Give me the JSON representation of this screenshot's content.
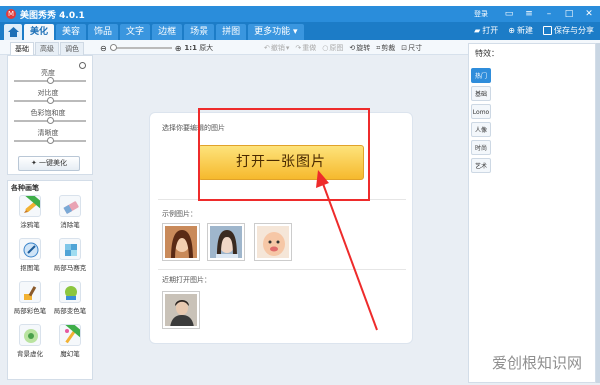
{
  "app": {
    "title": "美图秀秀 4.0.1",
    "logo_glyph": "M",
    "login": "登录"
  },
  "window_controls": {
    "skin_icon": "skin-icon",
    "menu_icon": "menu-icon",
    "minimize": "–",
    "maximize": "□",
    "close": "✕"
  },
  "menu": {
    "tabs": [
      {
        "label": "美化",
        "active": true
      },
      {
        "label": "美容",
        "active": false
      },
      {
        "label": "饰品",
        "active": false
      },
      {
        "label": "文字",
        "active": false
      },
      {
        "label": "边框",
        "active": false
      },
      {
        "label": "场景",
        "active": false
      },
      {
        "label": "拼图",
        "active": false
      },
      {
        "label": "更多功能 ▾",
        "active": false
      }
    ],
    "right": {
      "open": "打开",
      "new": "新建",
      "save_share": "保存与分享"
    }
  },
  "subtabs": [
    "基础",
    "高级",
    "调色"
  ],
  "toolbar": {
    "original_size": "原大",
    "undo": "撤销",
    "redo": "重做",
    "original_image": "原图",
    "rotate": "旋转",
    "crop": "剪裁",
    "resize": "尺寸"
  },
  "adjustments": [
    {
      "label": "亮度",
      "level": 0.5
    },
    {
      "label": "对比度",
      "level": 0.5
    },
    {
      "label": "色彩饱和度",
      "level": 0.5
    },
    {
      "label": "清晰度",
      "level": 0.5
    }
  ],
  "one_key_beautify": "一键美化",
  "brushes": {
    "title": "各种画笔",
    "items": [
      "涂鸦笔",
      "消除笔",
      "抠图笔",
      "局部马赛克",
      "局部彩色笔",
      "局部变色笔",
      "背景虚化",
      "魔幻笔"
    ]
  },
  "canvas": {
    "prompt": "选择你要编辑的图片",
    "open_button": "打开一张图片",
    "sample_label": "示例图片：",
    "recent_label": "近期打开图片："
  },
  "effects": {
    "title": "特效：",
    "tabs": [
      {
        "label": "热门",
        "active": true
      },
      {
        "label": "基础",
        "active": false
      },
      {
        "label": "Lomo",
        "active": false
      },
      {
        "label": "人像",
        "active": false
      },
      {
        "label": "时尚",
        "active": false
      },
      {
        "label": "艺术",
        "active": false
      }
    ]
  },
  "colors": {
    "title_bar": "#2a8ddb",
    "menu_bar": "#1c7cc7",
    "button_yellow": "#f6b92d",
    "annotation_red": "#ee2b2b"
  },
  "watermark": "爱创根知识网"
}
